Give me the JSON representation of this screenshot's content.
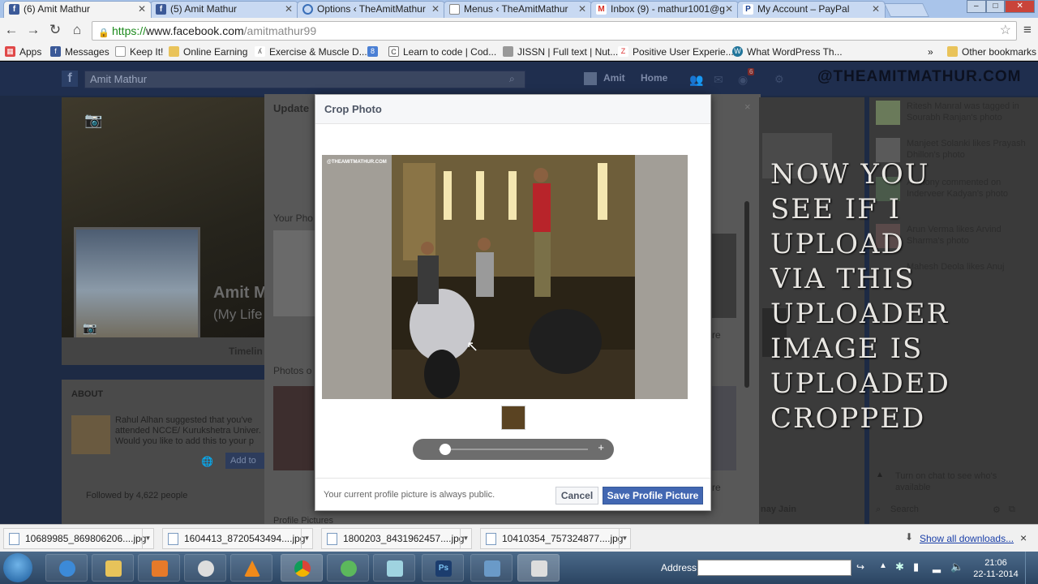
{
  "browser": {
    "tabs": [
      {
        "title": "(6) Amit Mathur",
        "icon": "facebook-icon",
        "active": true
      },
      {
        "title": "(5) Amit Mathur",
        "icon": "facebook-icon"
      },
      {
        "title": "Options ‹ TheAmitMathur",
        "icon": "loading-icon"
      },
      {
        "title": "Menus ‹ TheAmitMathur",
        "icon": "page-icon"
      },
      {
        "title": "Inbox (9) - mathur1001@g",
        "icon": "gmail-icon"
      },
      {
        "title": "My Account – PayPal",
        "icon": "paypal-icon"
      }
    ],
    "url_scheme": "https://",
    "url_host": "www.facebook.com",
    "url_path": "/amitmathur99",
    "bookmarks": [
      "Apps",
      "Messages",
      "Keep It!",
      "Online Earning",
      "Exercise & Muscle D...",
      "Learn to code | Cod...",
      "JISSN | Full text | Nut...",
      "Positive User Experie...",
      "What WordPress Th..."
    ],
    "more_bookmarks": "»",
    "other_bookmarks": "Other bookmarks"
  },
  "facebook": {
    "search_value": "Amit Mathur",
    "nav_user": "Amit",
    "nav_home": "Home",
    "notification_count": "6",
    "watermark": "@THEAMITMATHUR.COM",
    "profile_name": "Amit M",
    "profile_tagline": "(My Life",
    "timeline_tab": "Timelin",
    "update_title": "Update",
    "your_photos": "Your Pho",
    "photos_of": "Photos o",
    "about_title": "ABOUT",
    "suggestion": "Rahul Alhan suggested that you've attended NCCE/ Kurukshetra Univer. Would you like to add this to your p",
    "add_button": "Add to",
    "followed": "Followed by 4,622 people",
    "profile_pictures": "Profile Pictures",
    "see_more_1": "re",
    "see_more_2": "re",
    "feed": [
      "Ritesh Manral was tagged in Sourabh Ranjan's photo",
      "Manjeet Solanki likes Prayash Dhillon's photo",
      "Anthony commented on Inderveer Kadyan's photo",
      "Arun Verma likes Arvind Sharma's photo",
      "Mahesh Deola likes Anuj"
    ],
    "chat_prompt": "Turn on chat to see who's available",
    "chat_search": "Search",
    "chat_name": "nay Jain",
    "overlay_caption": [
      "NOW YOU",
      "SEE IF I",
      "UPLOAD",
      "VIA THIS",
      "UPLOADER",
      "IMAGE IS",
      "UPLOADED",
      "CROPPED"
    ]
  },
  "crop_dialog": {
    "title": "Crop Photo",
    "photo_watermark": "@THEAMITMATHUR.COM",
    "note": "Your current profile picture is always public.",
    "cancel_label": "Cancel",
    "save_label": "Save Profile Picture",
    "zoom_plus": "+",
    "zoom_level": 0.05
  },
  "downloads": {
    "files": [
      "10689985_869806206....jpg",
      "1604413_8720543494....jpg",
      "1800203_8431962457....jpg",
      "10410354_757324877....jpg"
    ],
    "show_all": "Show all downloads...",
    "close": "×"
  },
  "taskbar": {
    "address_label": "Address",
    "time": "21:06",
    "date": "22-11-2014"
  },
  "colors": {
    "facebook_blue": "#3b5998",
    "save_button": "#4267b2",
    "chrome_tab_bar": "#a9c4ea"
  }
}
